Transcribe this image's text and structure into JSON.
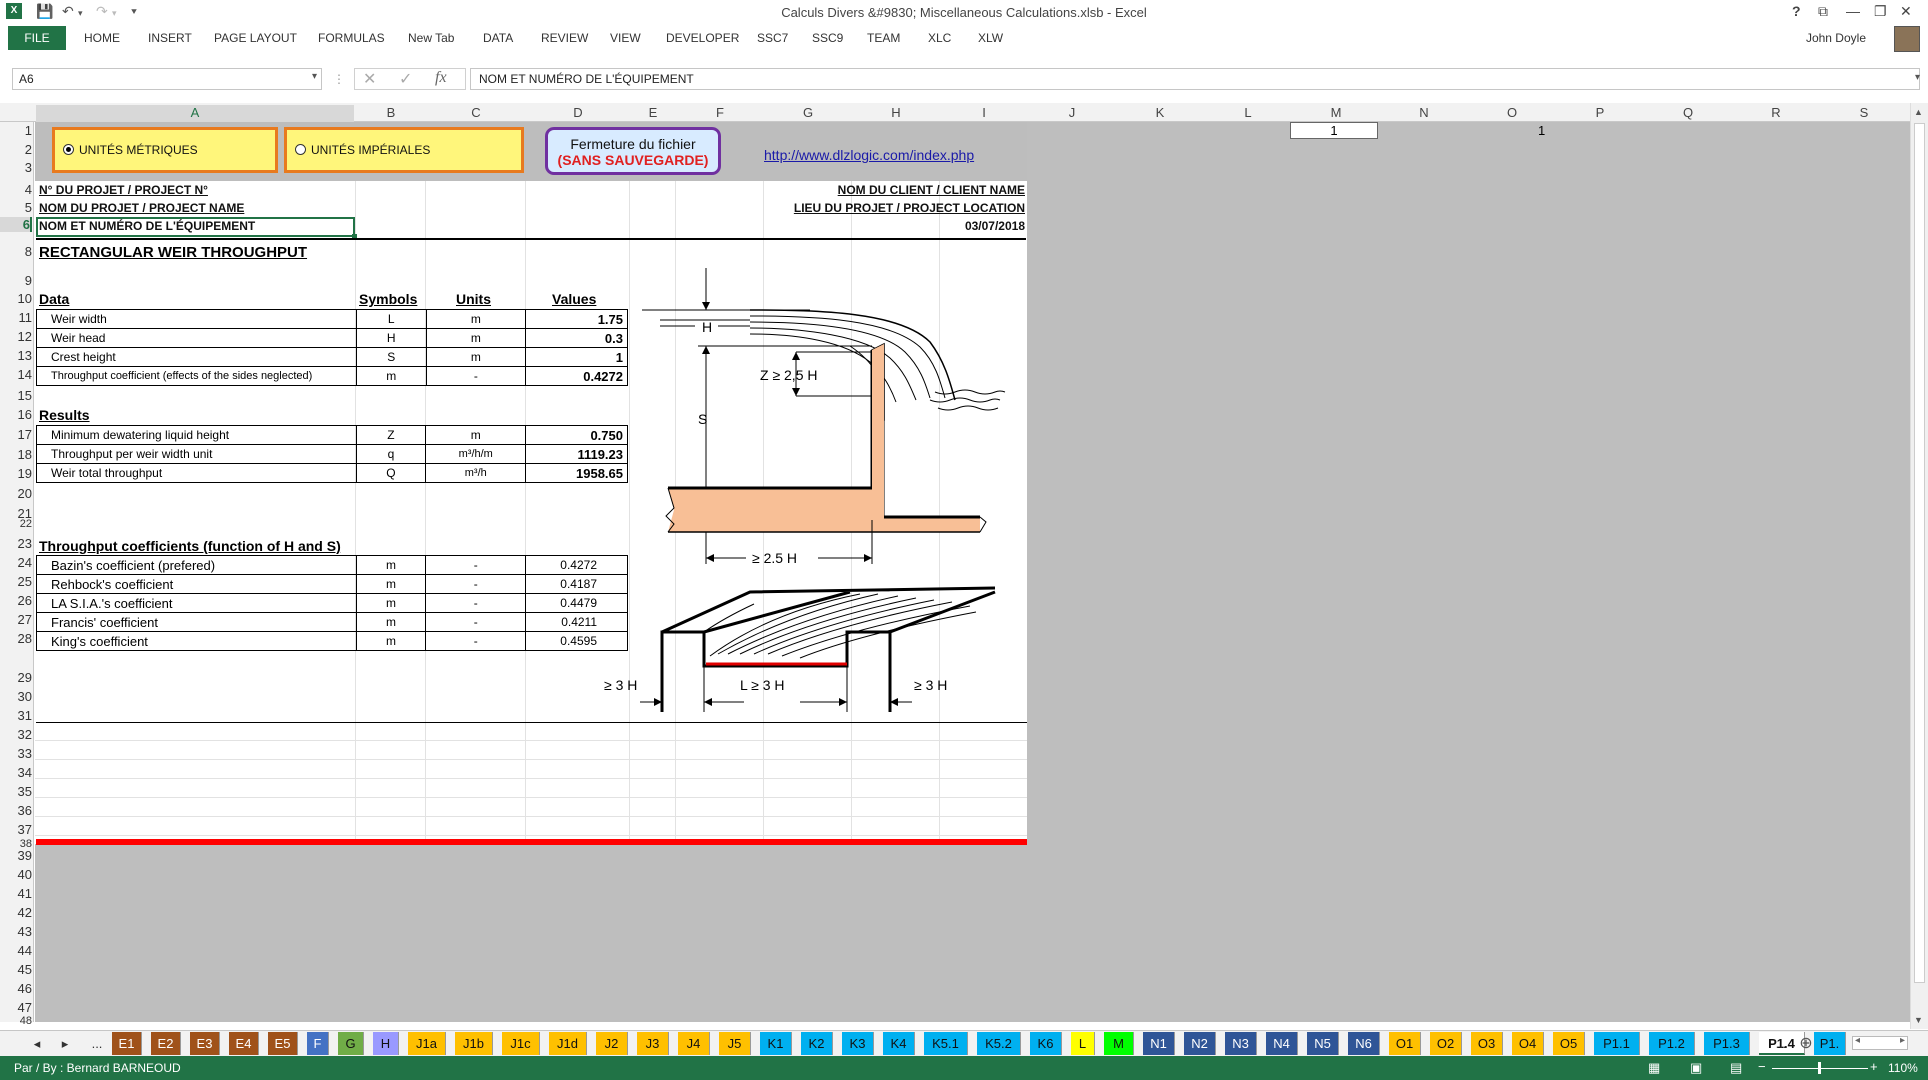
{
  "window": {
    "title": "Calculs Divers &#9830; Miscellaneous Calculations.xlsb - Excel",
    "help": "?",
    "minimize": "—",
    "restore": "❐",
    "close": "✕"
  },
  "ribbon": {
    "file": "FILE",
    "tabs": [
      "HOME",
      "INSERT",
      "PAGE LAYOUT",
      "FORMULAS",
      "New Tab",
      "DATA",
      "REVIEW",
      "VIEW",
      "DEVELOPER",
      "SSC7",
      "SSC9",
      "TEAM",
      "XLC",
      "XLW"
    ],
    "user": "John Doyle"
  },
  "formula_bar": {
    "name_box": "A6",
    "formula": "NOM ET NUMÉRO DE L'ÉQUIPEMENT",
    "fx": "fx"
  },
  "columns": [
    "A",
    "B",
    "C",
    "D",
    "E",
    "F",
    "G",
    "H",
    "I",
    "J",
    "K",
    "L",
    "M",
    "N",
    "O",
    "P",
    "Q",
    "R",
    "S"
  ],
  "rows": [
    "1",
    "2",
    "3",
    "4",
    "5",
    "6",
    "8",
    "9",
    "10",
    "11",
    "12",
    "13",
    "14",
    "15",
    "16",
    "17",
    "18",
    "19",
    "20",
    "21",
    "22",
    "23",
    "24",
    "25",
    "26",
    "27",
    "28",
    "29",
    "30",
    "31",
    "32",
    "33",
    "34",
    "35",
    "36",
    "37",
    "38",
    "39",
    "40",
    "41",
    "42",
    "43",
    "44",
    "45",
    "46",
    "47",
    "48"
  ],
  "top": {
    "metric": "UNITÉS MÉTRIQUES",
    "imperial": "UNITÉS IMPÉRIALES",
    "close_line1": "Fermeture du fichier",
    "close_line2": "(SANS SAUVEGARDE)",
    "link": "http://www.dlzlogic.com/index.php",
    "m1_value": "1",
    "o1_value": "1"
  },
  "header": {
    "project_no": "N° DU PROJET / PROJECT N°",
    "project_name": "NOM DU PROJET / PROJECT NAME",
    "equipment": "NOM ET NUMÉRO DE L'ÉQUIPEMENT",
    "client": "NOM DU CLIENT / CLIENT NAME",
    "location": "LIEU DU PROJET / PROJECT LOCATION",
    "date": "03/07/2018"
  },
  "title": "RECTANGULAR WEIR THROUGHPUT",
  "data_section": {
    "label": "Data",
    "col_symbols": "Symbols",
    "col_units": "Units",
    "col_values": "Values",
    "rows": [
      {
        "label": "Weir width",
        "symbol": "L",
        "unit": "m",
        "value": "1.75"
      },
      {
        "label": "Weir head",
        "symbol": "H",
        "unit": "m",
        "value": "0.3"
      },
      {
        "label": "Crest height",
        "symbol": "S",
        "unit": "m",
        "value": "1"
      },
      {
        "label": "Throughput coefficient (effects of the sides neglected)",
        "symbol": "m",
        "unit": "-",
        "value": "0.4272"
      }
    ]
  },
  "results_section": {
    "label": "Results",
    "rows": [
      {
        "label": "Minimum dewatering liquid height",
        "symbol": "Z",
        "unit": "m",
        "value": "0.750"
      },
      {
        "label": "Throughput per weir width unit",
        "symbol": "q",
        "unit": "m³/h/m",
        "value": "1119.23"
      },
      {
        "label": "Weir total throughput",
        "symbol": "Q",
        "unit": "m³/h",
        "value": "1958.65"
      }
    ]
  },
  "coef_section": {
    "label": "Throughput coefficients (function of H and S)",
    "rows": [
      {
        "label": "Bazin's coefficient (prefered)",
        "symbol": "m",
        "unit": "-",
        "value": "0.4272"
      },
      {
        "label": "Rehbock's coefficient",
        "symbol": "m",
        "unit": "-",
        "value": "0.4187"
      },
      {
        "label": "LA S.I.A.'s coefficient",
        "symbol": "m",
        "unit": "-",
        "value": "0.4479"
      },
      {
        "label": "Francis' coefficient",
        "symbol": "m",
        "unit": "-",
        "value": "0.4211"
      },
      {
        "label": "King's coefficient",
        "symbol": "m",
        "unit": "-",
        "value": "0.4595"
      }
    ]
  },
  "diagram": {
    "h": "H",
    "z": "Z ≥ 2,5 H",
    "s": "S",
    "d25": "≥ 2.5  H",
    "l3h": "L ≥ 3 H",
    "left3h": "≥ 3 H",
    "right3h": "≥ 3 H"
  },
  "sheet_tabs": [
    {
      "label": "E1",
      "color": "#a0521a"
    },
    {
      "label": "E2",
      "color": "#a0521a"
    },
    {
      "label": "E3",
      "color": "#a0521a"
    },
    {
      "label": "E4",
      "color": "#a0521a"
    },
    {
      "label": "E5",
      "color": "#a0521a"
    },
    {
      "label": "F",
      "color": "#4472c4"
    },
    {
      "label": "G",
      "color": "#70ad47"
    },
    {
      "label": "H",
      "color": "#9999ff"
    },
    {
      "label": "J1a",
      "color": "#ffc000"
    },
    {
      "label": "J1b",
      "color": "#ffc000"
    },
    {
      "label": "J1c",
      "color": "#ffc000"
    },
    {
      "label": "J1d",
      "color": "#ffc000"
    },
    {
      "label": "J2",
      "color": "#ffc000"
    },
    {
      "label": "J3",
      "color": "#ffc000"
    },
    {
      "label": "J4",
      "color": "#ffc000"
    },
    {
      "label": "J5",
      "color": "#ffc000"
    },
    {
      "label": "K1",
      "color": "#00b0f0"
    },
    {
      "label": "K2",
      "color": "#00b0f0"
    },
    {
      "label": "K3",
      "color": "#00b0f0"
    },
    {
      "label": "K4",
      "color": "#00b0f0"
    },
    {
      "label": "K5.1",
      "color": "#00b0f0"
    },
    {
      "label": "K5.2",
      "color": "#00b0f0"
    },
    {
      "label": "K6",
      "color": "#00b0f0"
    },
    {
      "label": "L",
      "color": "#ffff00"
    },
    {
      "label": "M",
      "color": "#00ff00"
    },
    {
      "label": "N1",
      "color": "#2f5597"
    },
    {
      "label": "N2",
      "color": "#2f5597"
    },
    {
      "label": "N3",
      "color": "#2f5597"
    },
    {
      "label": "N4",
      "color": "#2f5597"
    },
    {
      "label": "N5",
      "color": "#2f5597"
    },
    {
      "label": "N6",
      "color": "#2f5597"
    },
    {
      "label": "O1",
      "color": "#ffc000"
    },
    {
      "label": "O2",
      "color": "#ffc000"
    },
    {
      "label": "O3",
      "color": "#ffc000"
    },
    {
      "label": "O4",
      "color": "#ffc000"
    },
    {
      "label": "O5",
      "color": "#ffc000"
    },
    {
      "label": "P1.1",
      "color": "#00b0f0"
    },
    {
      "label": "P1.2",
      "color": "#00b0f0"
    },
    {
      "label": "P1.3",
      "color": "#00b0f0"
    },
    {
      "label": "P1.4",
      "color": "#ffffff",
      "active": true
    },
    {
      "label": "P1.",
      "color": "#00b0f0"
    }
  ],
  "tab_nav": {
    "prev": "◂",
    "next": "▸",
    "more_left": "...",
    "more_right": "...",
    "add": "⊕"
  },
  "status": {
    "author": "Par / By : Bernard BARNEOUD",
    "zoom": "110%"
  }
}
